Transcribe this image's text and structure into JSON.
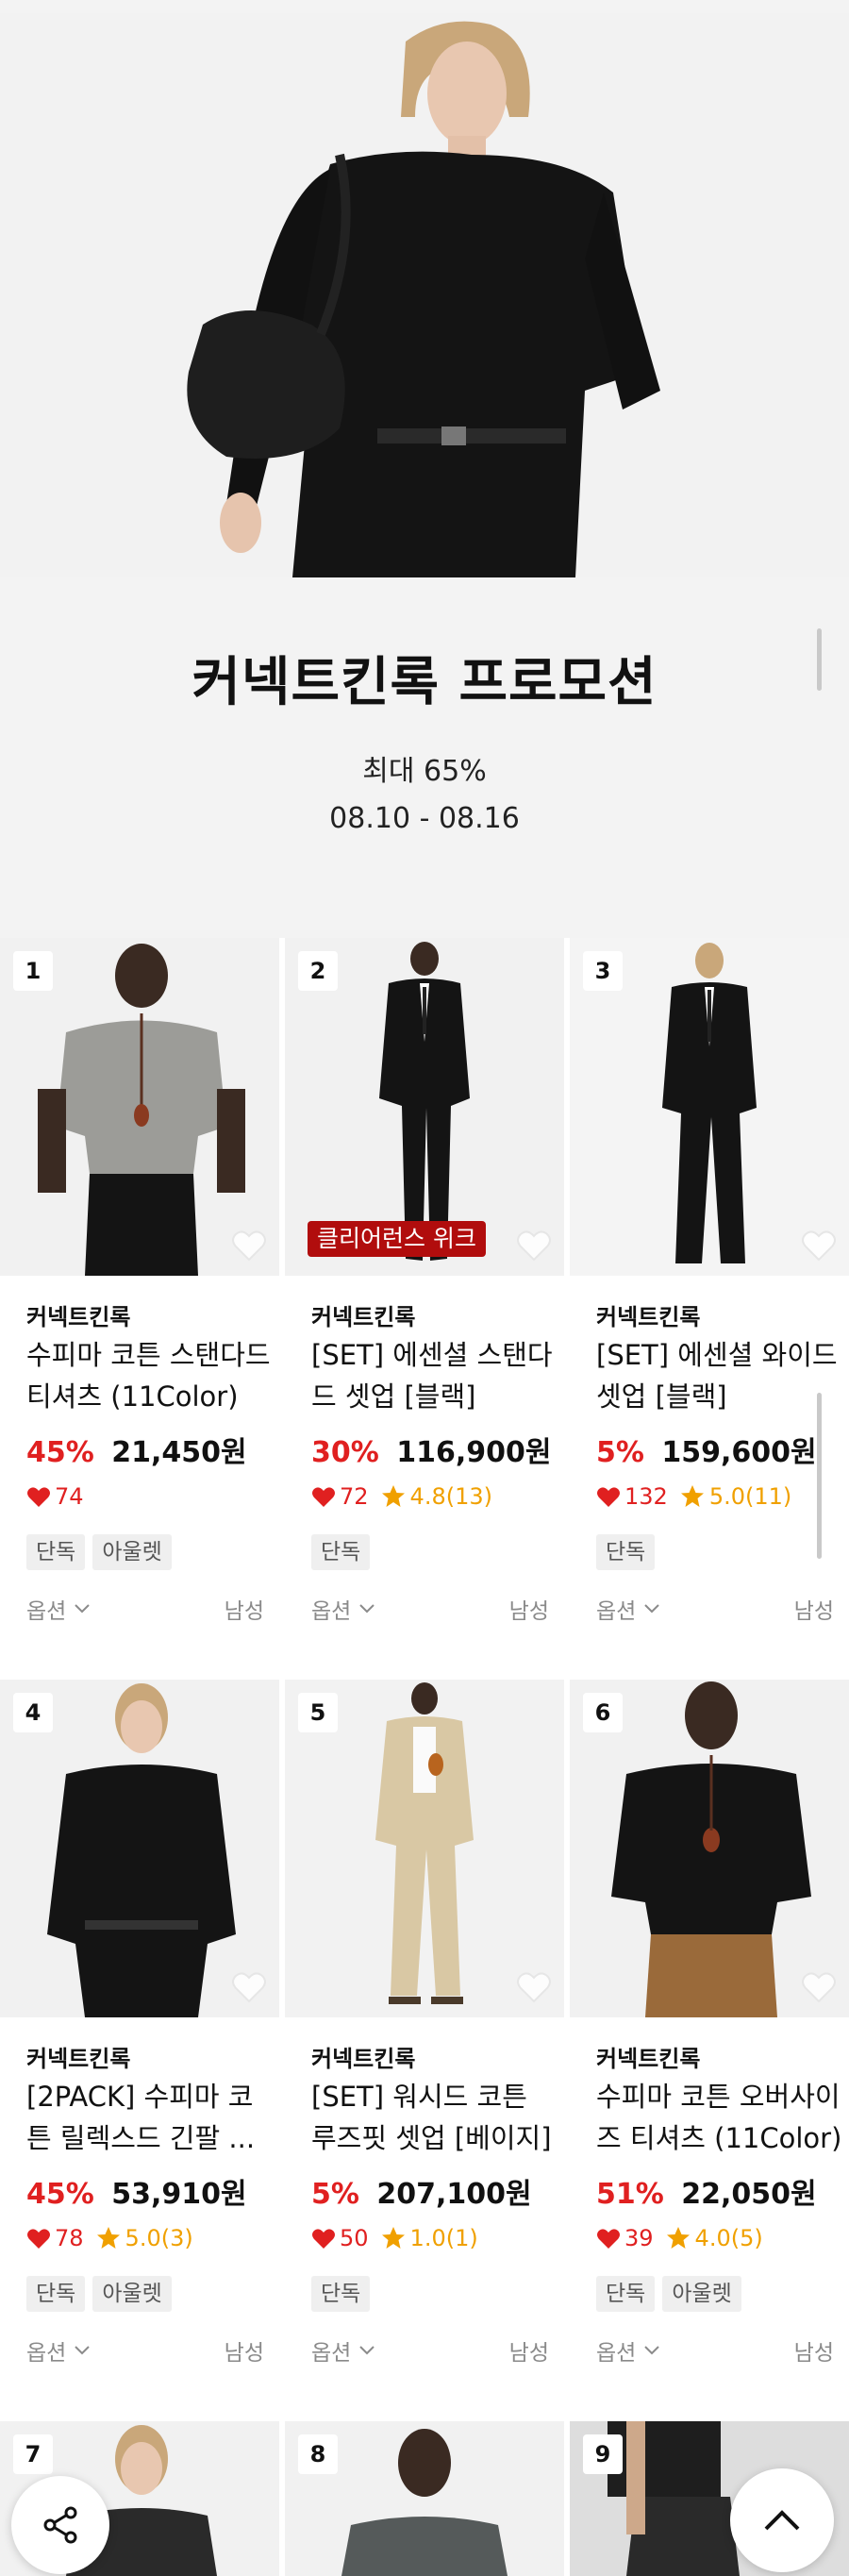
{
  "promo": {
    "title": "커넥트킨록 프로모션",
    "subtitle": "최대 65%",
    "dates": "08.10 - 08.16"
  },
  "products": [
    {
      "rank": "1",
      "brand": "커넥트킨록",
      "name": "수피마 코튼 스탠다드 티셔츠 (11Color)",
      "discount": "45%",
      "price": "21,450원",
      "likes": "74",
      "rating": "",
      "tags": [
        "단독",
        "아울렛"
      ],
      "option": "옵션",
      "gender": "남성",
      "badge": ""
    },
    {
      "rank": "2",
      "brand": "커넥트킨록",
      "name": "[SET] 에센셜 스탠다드 셋업 [블랙]",
      "discount": "30%",
      "price": "116,900원",
      "likes": "72",
      "rating": "4.8(13)",
      "tags": [
        "단독"
      ],
      "option": "옵션",
      "gender": "남성",
      "badge": "클리어런스 위크"
    },
    {
      "rank": "3",
      "brand": "커넥트킨록",
      "name": "[SET] 에센셜 와이드 셋업 [블랙]",
      "discount": "5%",
      "price": "159,600원",
      "likes": "132",
      "rating": "5.0(11)",
      "tags": [
        "단독"
      ],
      "option": "옵션",
      "gender": "남성",
      "badge": ""
    },
    {
      "rank": "4",
      "brand": "커넥트킨록",
      "name": "[2PACK] 수피마 코튼 릴렉스드 긴팔 ...",
      "discount": "45%",
      "price": "53,910원",
      "likes": "78",
      "rating": "5.0(3)",
      "tags": [
        "단독",
        "아울렛"
      ],
      "option": "옵션",
      "gender": "남성",
      "badge": ""
    },
    {
      "rank": "5",
      "brand": "커넥트킨록",
      "name": "[SET] 워시드 코튼 루즈핏 셋업 [베이지]",
      "discount": "5%",
      "price": "207,100원",
      "likes": "50",
      "rating": "1.0(1)",
      "tags": [
        "단독"
      ],
      "option": "옵션",
      "gender": "남성",
      "badge": ""
    },
    {
      "rank": "6",
      "brand": "커넥트킨록",
      "name": "수피마 코튼 오버사이즈 티셔츠 (11Color)",
      "discount": "51%",
      "price": "22,050원",
      "likes": "39",
      "rating": "4.0(5)",
      "tags": [
        "단독",
        "아울렛"
      ],
      "option": "옵션",
      "gender": "남성",
      "badge": ""
    }
  ],
  "next_row": [
    {
      "rank": "7"
    },
    {
      "rank": "8"
    },
    {
      "rank": "9"
    }
  ],
  "colors": {
    "discount": "#e02020",
    "rating": "#f0a000",
    "badge": "#b10d0d"
  },
  "icons": {
    "share": "share-icon",
    "scroll_top": "chevron-up-icon",
    "wishlist": "heart-outline-icon"
  }
}
